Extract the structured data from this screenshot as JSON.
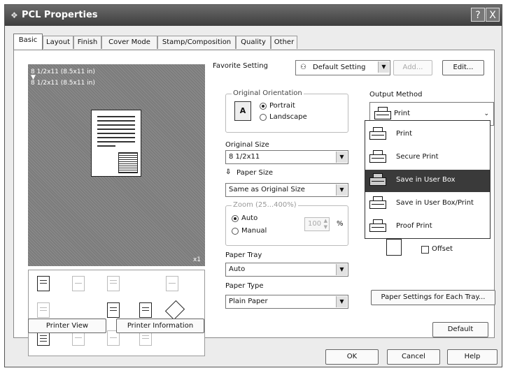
{
  "window": {
    "title": "PCL Properties",
    "help_button": "?",
    "close_button": "X"
  },
  "tabs": [
    "Basic",
    "Layout",
    "Finish",
    "Cover Mode",
    "Stamp/Composition",
    "Quality",
    "Other"
  ],
  "preview": {
    "size_line_1": "8 1/2x11 (8.5x11 in)",
    "size_line_2": "8 1/2x11 (8.5x11 in)",
    "copies": "x1"
  },
  "bottom_left": {
    "printer_view": "Printer View",
    "printer_information": "Printer Information"
  },
  "favorite": {
    "label": "Favorite Setting",
    "value": "Default Setting",
    "add": "Add...",
    "edit": "Edit..."
  },
  "orientation": {
    "title": "Original Orientation",
    "portrait": "Portrait",
    "landscape": "Landscape"
  },
  "original_size": {
    "label": "Original Size",
    "value": "8 1/2x11"
  },
  "paper_size": {
    "label": "Paper Size",
    "value": "Same as Original Size"
  },
  "zoom": {
    "title": "Zoom (25...400%)",
    "auto": "Auto",
    "manual": "Manual",
    "value": "100",
    "unit": "%"
  },
  "paper_tray": {
    "label": "Paper Tray",
    "value": "Auto"
  },
  "paper_type": {
    "label": "Paper Type",
    "value": "Plain Paper"
  },
  "output": {
    "label": "Output Method",
    "value": "Print",
    "options": [
      "Print",
      "Secure Print",
      "Save in User Box",
      "Save in User Box/Print",
      "Proof Print"
    ],
    "highlighted": "Save in User Box"
  },
  "offset": {
    "label": "Offset"
  },
  "paper_settings_each_tray": "Paper Settings for Each Tray...",
  "default_button": "Default",
  "dialog_buttons": {
    "ok": "OK",
    "cancel": "Cancel",
    "help": "Help"
  }
}
